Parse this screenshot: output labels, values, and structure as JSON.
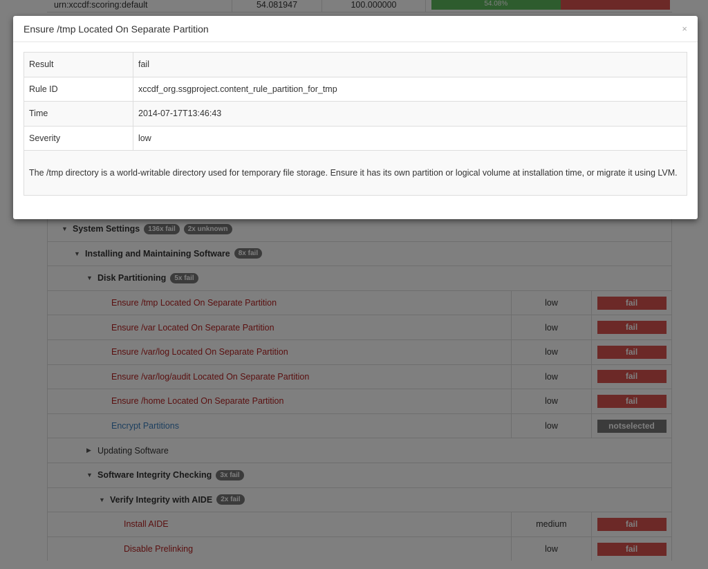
{
  "score": {
    "system": "urn:xccdf:scoring:default",
    "score": "54.081947",
    "max": "100.000000",
    "percent_label": "54.08%",
    "percent": 54.08
  },
  "tree": [
    {
      "kind": "group",
      "label": "System Settings",
      "badges": [
        "136x fail",
        "2x unknown"
      ]
    },
    {
      "kind": "group",
      "label": "Installing and Maintaining Software",
      "badges": [
        "8x fail"
      ]
    },
    {
      "kind": "group",
      "label": "Disk Partitioning",
      "badges": [
        "5x fail"
      ]
    },
    {
      "kind": "rule",
      "label": "Ensure /tmp Located On Separate Partition",
      "severity": "low",
      "result": "fail"
    },
    {
      "kind": "rule",
      "label": "Ensure /var Located On Separate Partition",
      "severity": "low",
      "result": "fail"
    },
    {
      "kind": "rule",
      "label": "Ensure /var/log Located On Separate Partition",
      "severity": "low",
      "result": "fail"
    },
    {
      "kind": "rule",
      "label": "Ensure /var/log/audit Located On Separate Partition",
      "severity": "low",
      "result": "fail"
    },
    {
      "kind": "rule",
      "label": "Ensure /home Located On Separate Partition",
      "severity": "low",
      "result": "fail"
    },
    {
      "kind": "rule",
      "label": "Encrypt Partitions",
      "severity": "low",
      "result": "notselected"
    },
    {
      "kind": "group",
      "label": "Updating Software",
      "badges": [],
      "collapsed": true
    },
    {
      "kind": "group",
      "label": "Software Integrity Checking",
      "badges": [
        "3x fail"
      ]
    },
    {
      "kind": "group",
      "label": "Verify Integrity with AIDE",
      "badges": [
        "2x fail"
      ]
    },
    {
      "kind": "rule",
      "label": "Install AIDE",
      "severity": "medium",
      "result": "fail"
    },
    {
      "kind": "rule",
      "label": "Disable Prelinking",
      "severity": "low",
      "result": "fail"
    }
  ],
  "modal": {
    "title": "Ensure /tmp Located On Separate Partition",
    "close": "×",
    "rows": [
      {
        "key": "Result",
        "value": "fail"
      },
      {
        "key": "Rule ID",
        "value": "xccdf_org.ssgproject.content_rule_partition_for_tmp"
      },
      {
        "key": "Time",
        "value": "2014-07-17T13:46:43"
      },
      {
        "key": "Severity",
        "value": "low"
      }
    ],
    "description": "The /tmp directory is a world-writable directory used for temporary file storage. Ensure it has its own partition or logical volume at installation time, or migrate it using LVM."
  },
  "colors": {
    "fail": "#d9534f",
    "notselected": "#777777",
    "pass": "#5cb85c",
    "rule_title": "#b52020",
    "link": "#3a7fbf"
  }
}
